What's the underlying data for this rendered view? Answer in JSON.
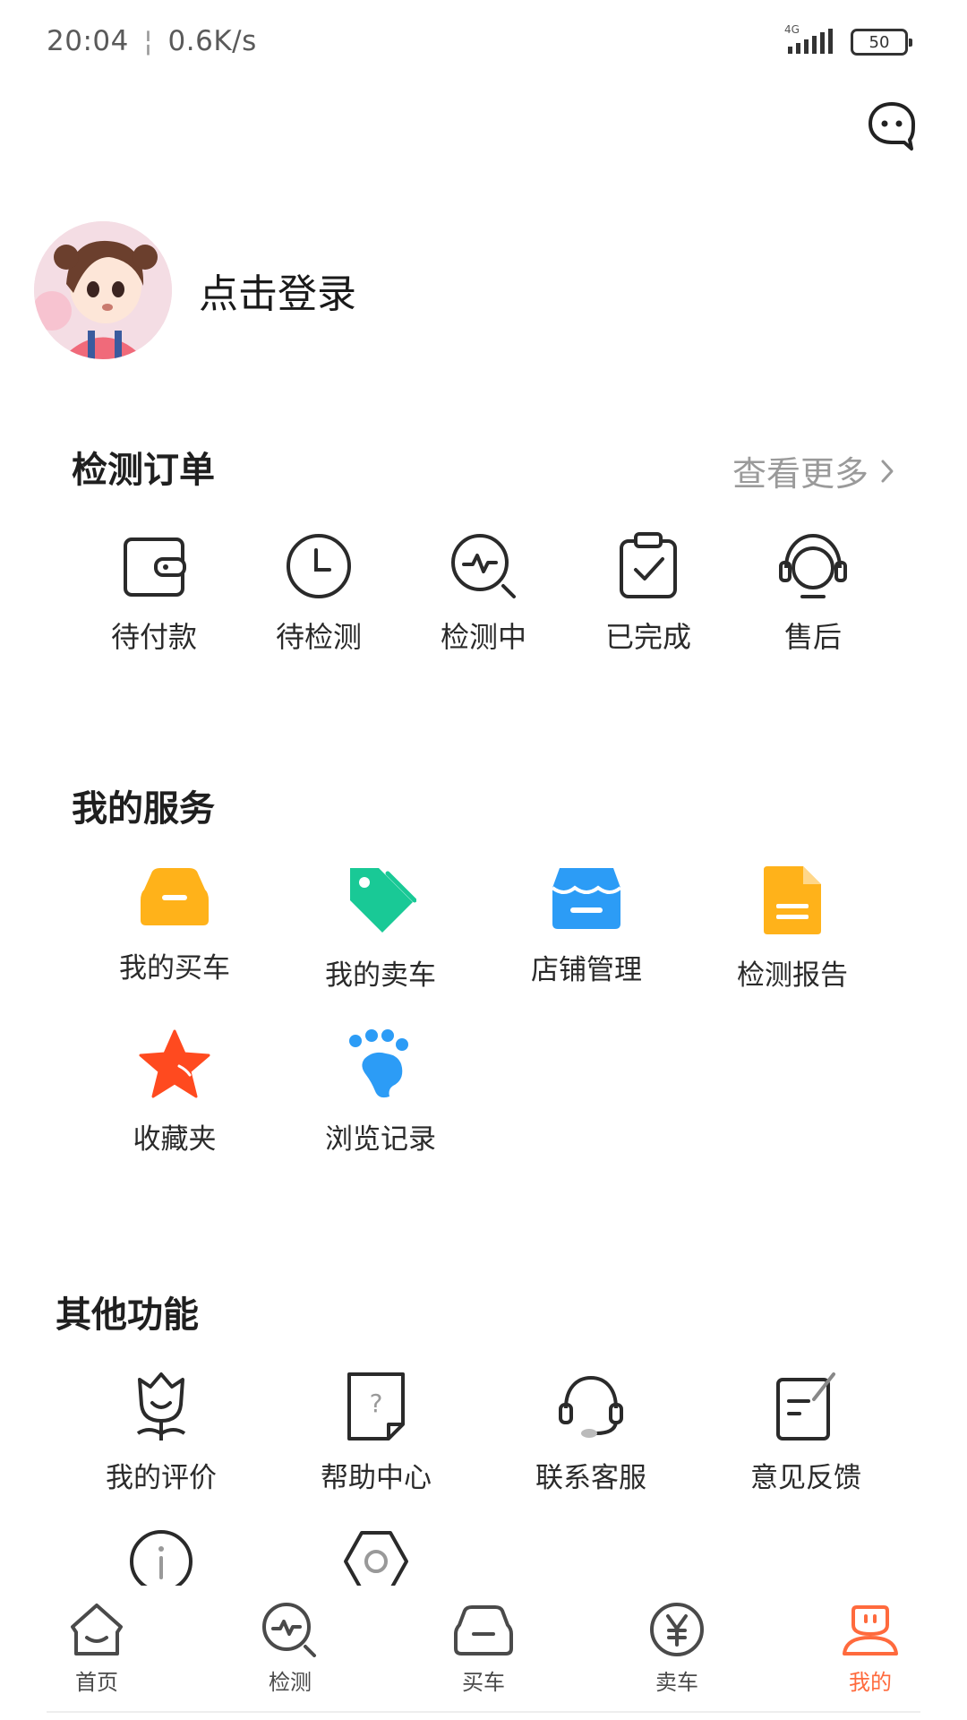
{
  "status_bar": {
    "time": "20:04",
    "speed": "0.6K/s",
    "network": "4G",
    "battery": "50"
  },
  "header": {
    "message_icon": "chat-bubble-icon"
  },
  "profile": {
    "login_text": "点击登录"
  },
  "orders": {
    "title": "检测订单",
    "more": "查看更多",
    "items": [
      {
        "label": "待付款",
        "icon": "wallet-icon"
      },
      {
        "label": "待检测",
        "icon": "clock-icon"
      },
      {
        "label": "检测中",
        "icon": "inspect-icon"
      },
      {
        "label": "已完成",
        "icon": "clipboard-check-icon"
      },
      {
        "label": "售后",
        "icon": "headset-icon"
      }
    ]
  },
  "services": {
    "title": "我的服务",
    "items": [
      {
        "label": "我的买车",
        "icon": "car-icon",
        "color": "#ffb21a"
      },
      {
        "label": "我的卖车",
        "icon": "tag-icon",
        "color": "#19c996"
      },
      {
        "label": "店铺管理",
        "icon": "store-icon",
        "color": "#2c9cf6"
      },
      {
        "label": "检测报告",
        "icon": "document-icon",
        "color": "#ffb21a"
      },
      {
        "label": "收藏夹",
        "icon": "star-icon",
        "color": "#ff4a1f"
      },
      {
        "label": "浏览记录",
        "icon": "footprint-icon",
        "color": "#2c9cf6"
      }
    ]
  },
  "other": {
    "title": "其他功能",
    "items": [
      {
        "label": "我的评价",
        "icon": "flower-icon"
      },
      {
        "label": "帮助中心",
        "icon": "help-doc-icon"
      },
      {
        "label": "联系客服",
        "icon": "headset-icon"
      },
      {
        "label": "意见反馈",
        "icon": "feedback-icon"
      },
      {
        "label": "",
        "icon": "info-icon"
      },
      {
        "label": "",
        "icon": "settings-icon"
      }
    ]
  },
  "tabs": [
    {
      "label": "首页",
      "icon": "home-icon"
    },
    {
      "label": "检测",
      "icon": "inspect-icon"
    },
    {
      "label": "买车",
      "icon": "car-icon"
    },
    {
      "label": "卖车",
      "icon": "yen-icon"
    },
    {
      "label": "我的",
      "icon": "profile-icon",
      "active": true
    }
  ],
  "colors": {
    "accent": "#ff6a3d",
    "text": "#1f1f1f",
    "muted": "#9a9a9a"
  }
}
